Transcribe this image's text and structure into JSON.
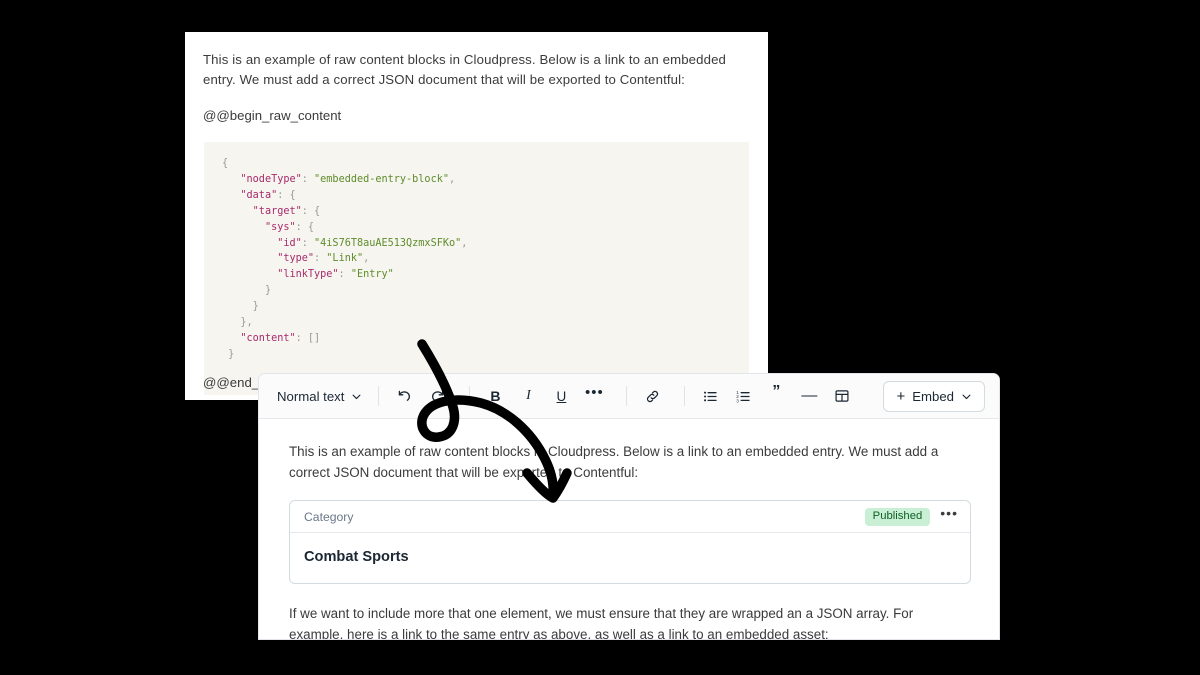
{
  "source_panel": {
    "paragraph": "This is an example of raw content blocks in Cloudpress. Below is a link to an embedded entry. We must add a correct JSON document that will be exported to Contentful:",
    "begin_marker": "@@begin_raw_content",
    "end_marker": "@@end_ra",
    "code": {
      "line_01_open": "{",
      "line_02_key": "\"nodeType\"",
      "line_02_val": "\"embedded-entry-block\"",
      "line_03_key": "\"data\"",
      "line_04_key": "\"target\"",
      "line_05_key": "\"sys\"",
      "line_06_key": "\"id\"",
      "line_06_val": "\"4iS76T8auAE513QzmxSFKo\"",
      "line_07_key": "\"type\"",
      "line_07_val": "\"Link\"",
      "line_08_key": "\"linkType\"",
      "line_08_val": "\"Entry\"",
      "line_09_close": "}",
      "line_10_close": "}",
      "line_11_close": "},",
      "line_12_key": "\"content\"",
      "line_12_val": "[]",
      "line_13_close": "}",
      "colors": {
        "key": "#a82a6b",
        "string": "#5f8c2b",
        "punctuation": "#9a9a90",
        "background": "#f6f5f0"
      }
    }
  },
  "editor": {
    "toolbar": {
      "style_dropdown": "Normal text",
      "chevron": "chevron-down-icon",
      "undo": "undo-icon",
      "redo": "redo-icon",
      "bold": "B",
      "italic": "I",
      "underline": "U",
      "more": "•••",
      "link": "link-icon",
      "bulleted_list": "bulleted-list-icon",
      "numbered_list": "numbered-list-icon",
      "quote": "”",
      "horizontal_rule": "—",
      "table": "table-icon",
      "embed_plus": "+",
      "embed_label": "Embed",
      "embed_chevron": "chevron-down-icon"
    },
    "body": {
      "paragraph_1": "This is an example of raw content blocks in Cloudpress. Below is a link to an embedded entry. We must add a correct JSON document that will be exported to Contentful:",
      "paragraph_2": "If we want to include more that one element, we must ensure that they are wrapped an a JSON array. For example, here is a link to the same entry as above, as well as a link to an embedded asset:"
    },
    "entry_card": {
      "content_type": "Category",
      "status": "Published",
      "menu": "•••",
      "title": "Combat Sports",
      "status_bg": "#c9f0d4",
      "status_fg": "#0e6027"
    }
  },
  "annotation": {
    "name": "curved-arrow-annotation",
    "color": "#000000"
  }
}
